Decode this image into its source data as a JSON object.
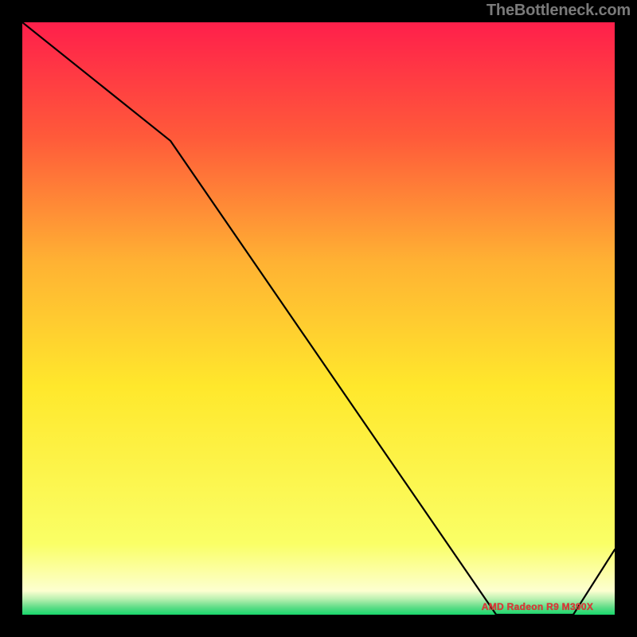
{
  "watermark": "TheBottleneck.com",
  "annotation": "AMD Radeon R9 M390X",
  "chart_data": {
    "type": "line",
    "title": "",
    "xlabel": "",
    "ylabel": "",
    "xlim": [
      0,
      100
    ],
    "ylim": [
      0,
      100
    ],
    "x": [
      0,
      25,
      80,
      87,
      93,
      100
    ],
    "values": [
      100,
      80,
      0,
      0,
      0,
      11
    ],
    "gradient_bands": [
      {
        "y_from": 100,
        "y_to": 80,
        "color_from": "#ff1f4b",
        "color_to": "#ff5a3a"
      },
      {
        "y_from": 80,
        "y_to": 55,
        "color_from": "#ff5a3a",
        "color_to": "#ffb233"
      },
      {
        "y_from": 55,
        "y_to": 30,
        "color_from": "#ffb233",
        "color_to": "#ffe82c"
      },
      {
        "y_from": 30,
        "y_to": 12,
        "color_from": "#ffe82c",
        "color_to": "#faff66"
      },
      {
        "y_from": 12,
        "y_to": 4,
        "color_from": "#faff66",
        "color_to": "#fdffd0"
      },
      {
        "y_from": 4,
        "y_to": 1,
        "color_from": "#fdffd0",
        "color_to": "#7de594"
      },
      {
        "y_from": 1,
        "y_to": 0,
        "color_from": "#7de594",
        "color_to": "#18d86b"
      }
    ],
    "annotation": {
      "text": "AMD Radeon R9 M390X",
      "x": 87,
      "y": 0.5
    }
  }
}
